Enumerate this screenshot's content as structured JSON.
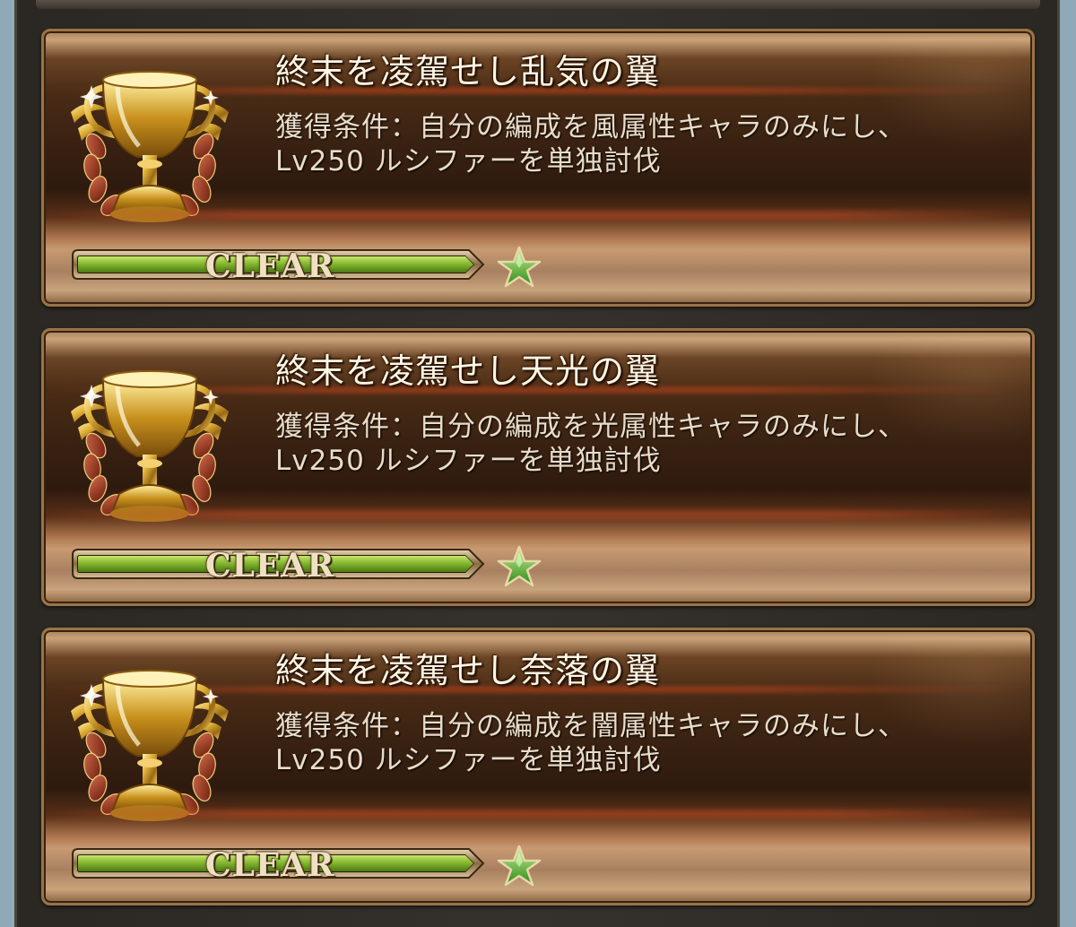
{
  "achievements": [
    {
      "title": "終末を凌駕せし乱気の翼",
      "condition_line1": "獲得条件：自分の編成を風属性キャラのみにし、",
      "condition_line2": "Lv250 ルシファーを単独討伐",
      "status": "CLEAR",
      "progress": 1.0,
      "icon": "trophy-icon"
    },
    {
      "title": "終末を凌駕せし天光の翼",
      "condition_line1": "獲得条件：自分の編成を光属性キャラのみにし、",
      "condition_line2": "Lv250 ルシファーを単独討伐",
      "status": "CLEAR",
      "progress": 1.0,
      "icon": "trophy-icon"
    },
    {
      "title": "終末を凌駕せし奈落の翼",
      "condition_line1": "獲得条件：自分の編成を闇属性キャラのみにし、",
      "condition_line2": "Lv250 ルシファーを単独討伐",
      "status": "CLEAR",
      "progress": 1.0,
      "icon": "trophy-icon"
    }
  ],
  "colors": {
    "bar_green": "#7fb02a",
    "star_green": "#5fc03a",
    "gold": "#d9a632"
  }
}
